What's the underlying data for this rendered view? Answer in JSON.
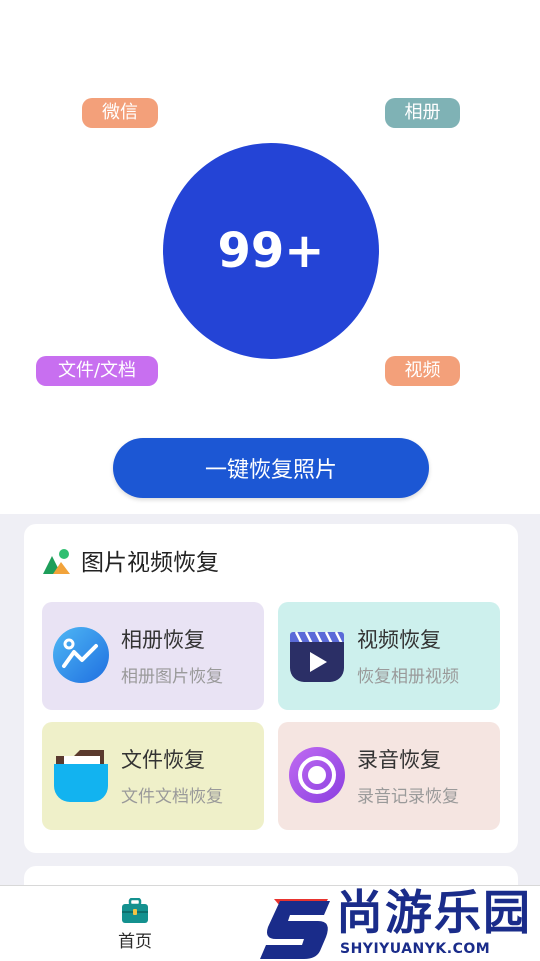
{
  "tags": {
    "wechat": "微信",
    "album": "相册",
    "documents": "文件/文档",
    "video": "视频"
  },
  "scan_count": "99+",
  "main_button": "一键恢复照片",
  "section": {
    "title": "图片视频恢复",
    "tiles": [
      {
        "name": "相册恢复",
        "sub": "相册图片恢复",
        "icon": "album-icon"
      },
      {
        "name": "视频恢复",
        "sub": "恢复相册视频",
        "icon": "video-icon"
      },
      {
        "name": "文件恢复",
        "sub": "文件文档恢复",
        "icon": "folder-icon"
      },
      {
        "name": "录音恢复",
        "sub": "录音记录恢复",
        "icon": "record-icon"
      }
    ]
  },
  "nav": {
    "home_label": "首页"
  },
  "watermark": {
    "text": "尚游乐园",
    "url": "SHYIYUANYK.COM"
  },
  "colors": {
    "primary": "#2444d6",
    "button": "#1c57d4",
    "tag_orange": "#f3a07a",
    "tag_teal": "#7fb2b5",
    "tag_purple": "#c86ff0"
  }
}
